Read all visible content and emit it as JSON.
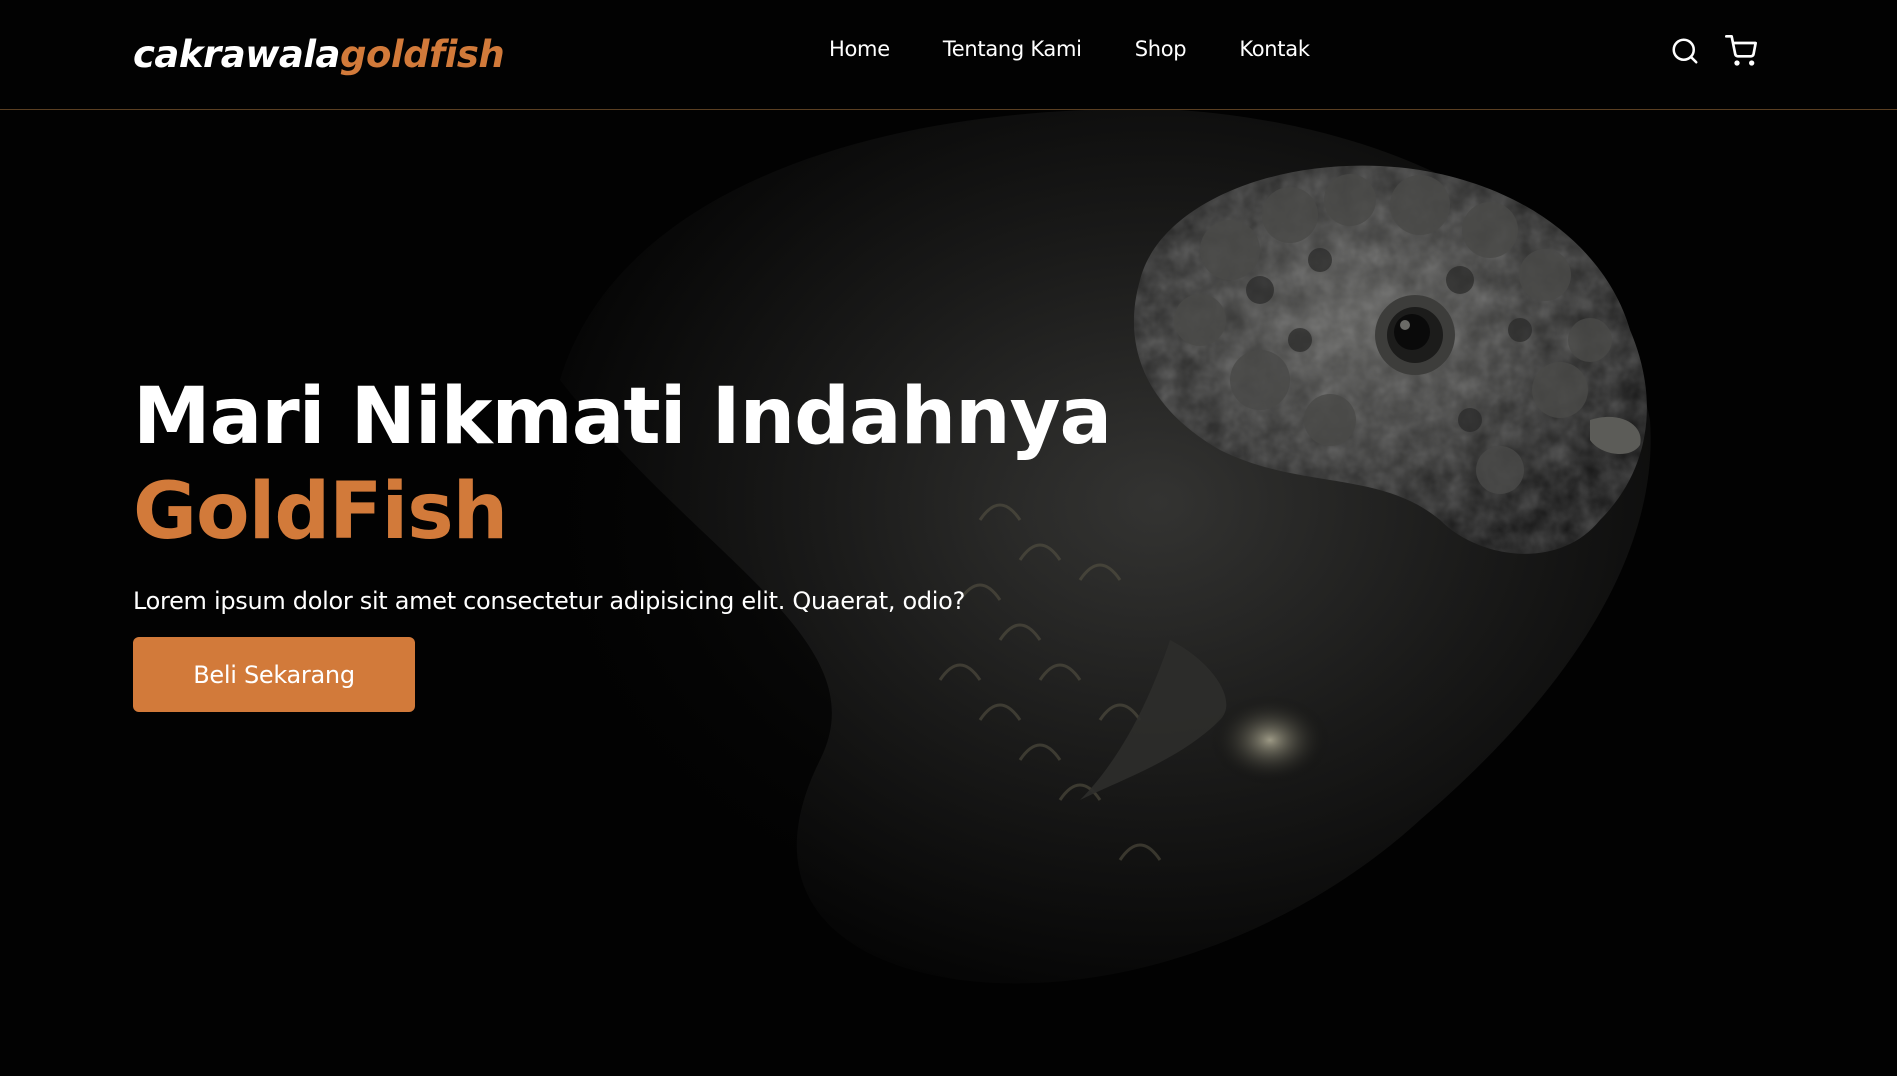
{
  "brand": {
    "name_part1": "cakrawala",
    "name_part2": "goldfish",
    "accent_color": "#d27a3a"
  },
  "nav": {
    "links": [
      {
        "label": "Home"
      },
      {
        "label": "Tentang Kami"
      },
      {
        "label": "Shop"
      },
      {
        "label": "Kontak"
      }
    ],
    "icons": [
      "search-icon",
      "cart-icon"
    ]
  },
  "hero": {
    "title_line1": "Mari Nikmati Indahnya",
    "title_line2": "GoldFish",
    "description": "Lorem ipsum dolor sit amet consectetur adipisicing elit. Quaerat, odio?",
    "cta_label": "Beli Sekarang",
    "background_image": "goldfish-photo"
  }
}
